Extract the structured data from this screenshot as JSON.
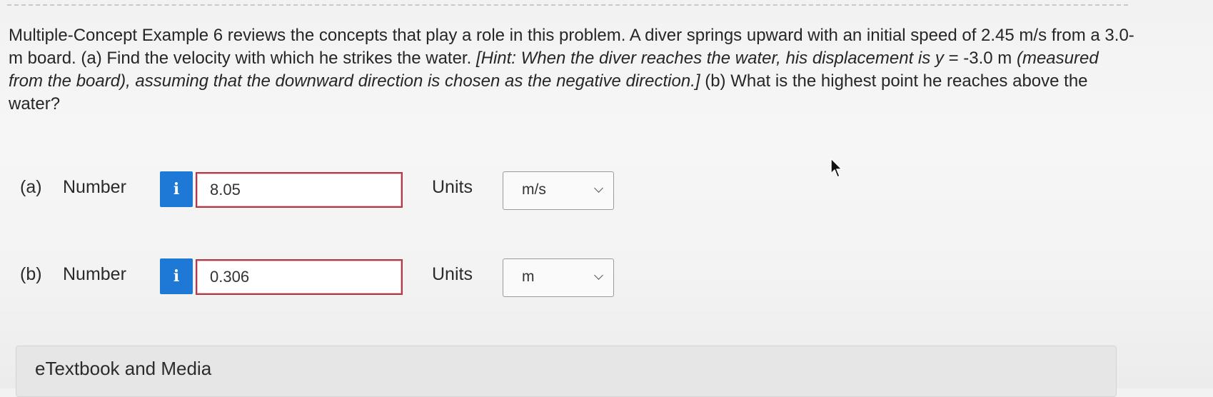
{
  "question": {
    "text_1": "Multiple-Concept Example 6 reviews the concepts that play a role in this problem. A diver springs upward with an initial speed of 2.45 m/s from a 3.0-m board. (a) Find the velocity with which he strikes the water. ",
    "hint": "[Hint: When the diver reaches the water, his displacement is y",
    "text_2": " = -3.0 m ",
    "hint_2": "(measured from the board), assuming that the downward direction is chosen as the negative direction.]",
    "text_3": " (b) What is the highest point he reaches above the water?"
  },
  "part_a": {
    "label": "(a)",
    "number_label": "Number",
    "info_icon": "i",
    "value": "8.05",
    "units_label": "Units",
    "units_value": "m/s"
  },
  "part_b": {
    "label": "(b)",
    "number_label": "Number",
    "info_icon": "i",
    "value": "0.306",
    "units_label": "Units",
    "units_value": "m"
  },
  "etextbook": {
    "title": "eTextbook and Media"
  },
  "colors": {
    "info_button": "#1d78d6",
    "answer_border": "#b03a48"
  },
  "icons": {
    "info": "info-icon",
    "dropdown": "chevron-down-icon",
    "cursor": "mouse-pointer-icon"
  }
}
